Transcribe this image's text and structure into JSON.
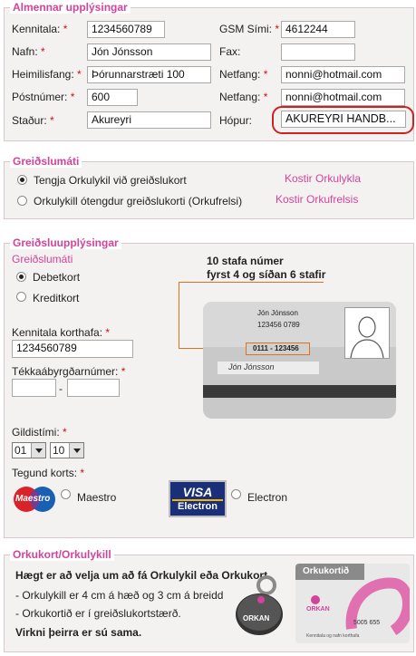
{
  "section1": {
    "legend": "Almennar upplýsingar",
    "kennitala": {
      "label": "Kennitala:",
      "value": "1234560789"
    },
    "gsm": {
      "label": "GSM Sími:",
      "value": "4612244"
    },
    "nafn": {
      "label": "Nafn:",
      "value": "Jón Jónsson"
    },
    "fax": {
      "label": "Fax:",
      "value": ""
    },
    "heimilisfang": {
      "label": "Heimilisfang:",
      "value": "Þórunnarstræti 100"
    },
    "netfang1": {
      "label": "Netfang:",
      "value": "nonni@hotmail.com"
    },
    "postnumer": {
      "label": "Póstnúmer:",
      "value": "600"
    },
    "netfang2": {
      "label": "Netfang:",
      "value": "nonni@hotmail.com"
    },
    "stadur": {
      "label": "Staður:",
      "value": "Akureyri"
    },
    "hopur": {
      "label": "Hópur:",
      "value": "AKUREYRI HANDB..."
    },
    "required_mark": "*"
  },
  "section2": {
    "legend": "Greiðslumáti",
    "option1": "Tengja Orkulykil við greiðslukort",
    "option2": "Orkulykill ótengdur greiðslukorti (Orkufrelsi)",
    "link1": "Kostir Orkulykla",
    "link2": "Kostir Orkufrelsis"
  },
  "section3": {
    "legend": "Greiðsluupplýsingar",
    "sublegend": "Greiðslumáti",
    "debet": "Debetkort",
    "kredit": "Kreditkort",
    "korthafi": {
      "label": "Kennitala korthafa:",
      "value": "1234560789"
    },
    "tekka": {
      "label": "Tékkaábyrgðarnúmer:",
      "value1": "",
      "dash": "-",
      "value2": ""
    },
    "gildistimi": {
      "label": "Gildistími:",
      "month": "01",
      "year": "10"
    },
    "tegund": "Tegund korts:",
    "maestro_logo": "Maestro",
    "maestro": "Maestro",
    "visa_logo_top": "VISA",
    "visa_logo_bottom": "Electron",
    "electron": "Electron",
    "callout_line1": "10 stafa númer",
    "callout_line2": "fyrst 4 og síðan 6 stafir",
    "card": {
      "name": "Jón Jónsson",
      "kt": "123456 0789",
      "number": "0111 - 123456",
      "signature": "Jón Jónsson"
    }
  },
  "section4": {
    "legend": "Orkukort/Orkulykill",
    "heading": "Hægt er að velja um að fá Orkulykil eða Orkukort.",
    "line1": "- Orkulykill er 4 cm á hæð og 3 cm á breidd",
    "line2": "- Orkukortið er í greiðslukortstærð.",
    "line3": "Virkni þeirra er sú sama.",
    "fob_text": "ORKAN",
    "card_title": "Orkukortið",
    "card_brand": "ORKAN",
    "card_number": "5005 655",
    "card_fine": "Kennitala og nafn korthafa"
  },
  "colors": {
    "accent": "#d2449a",
    "required": "#d01010",
    "highlight_ring": "#cc2222"
  }
}
